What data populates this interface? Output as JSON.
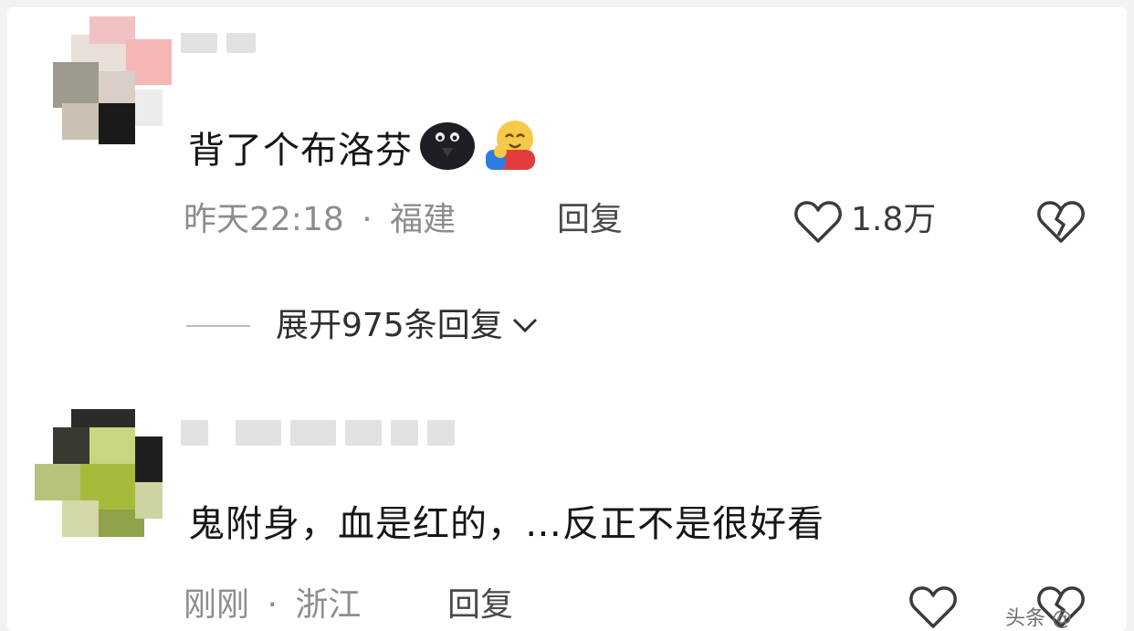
{
  "comments": [
    {
      "text": "背了个布洛芬",
      "time": "昨天22:18",
      "sep": "·",
      "location": "福建",
      "reply_label": "回复",
      "likes": "1.8万",
      "emoji_1": "dark-blob-emoji",
      "emoji_2": "hugging-face-emoji"
    },
    {
      "text": "鬼附身，血是红的，…反正不是很好看",
      "time": "刚刚",
      "sep": "·",
      "location": "浙江",
      "reply_label": "回复"
    }
  ],
  "expand_replies": "展开975条回复",
  "watermark": "头条 @ "
}
